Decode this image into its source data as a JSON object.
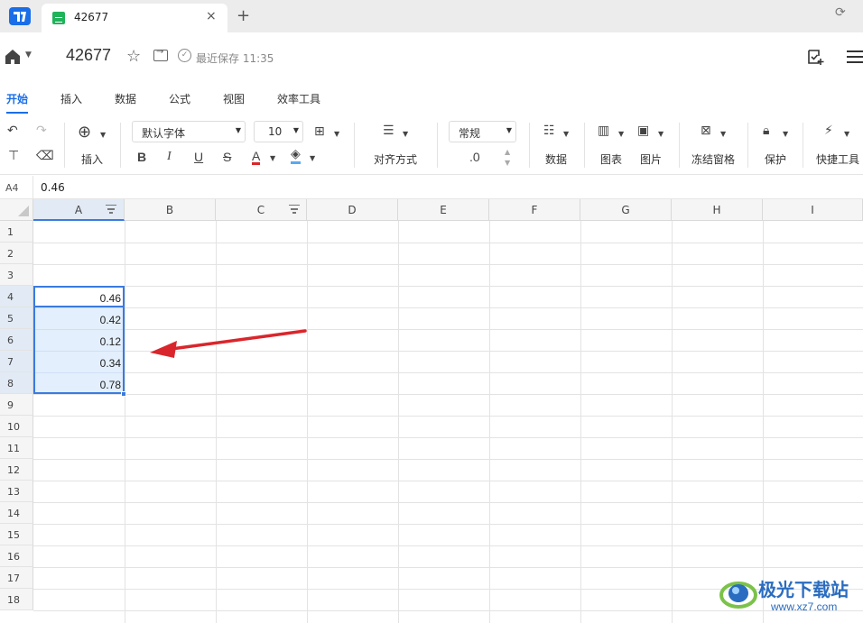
{
  "tab": {
    "title": "42677",
    "close": "×",
    "new": "+"
  },
  "header": {
    "title": "42677",
    "saved": "最近保存 11:35"
  },
  "ribbon_tabs": [
    "开始",
    "插入",
    "数据",
    "公式",
    "视图",
    "效率工具"
  ],
  "toolbar": {
    "insert_label": "插入",
    "font_name": "默认字体",
    "font_size": "10",
    "align_label": "对齐方式",
    "number_format": "常规",
    "decimal": ".0",
    "data_label": "数据",
    "chart_label": "图表",
    "image_label": "图片",
    "freeze_label": "冻结窗格",
    "protect_label": "保护",
    "quick_tools_label": "快捷工具",
    "bold": "B",
    "italic": "I",
    "underline": "U",
    "strike": "S",
    "font_color": "A"
  },
  "formula_bar": {
    "cell_ref": "A4",
    "value": "0.46"
  },
  "columns": [
    "A",
    "B",
    "C",
    "D",
    "E",
    "F",
    "G",
    "H",
    "I"
  ],
  "rows": [
    "1",
    "2",
    "3",
    "4",
    "5",
    "6",
    "7",
    "8",
    "9",
    "10",
    "11",
    "12",
    "13",
    "14",
    "15",
    "16",
    "17",
    "18"
  ],
  "cells": {
    "A4": "0.46",
    "A5": "0.42",
    "A6": "0.12",
    "A7": "0.34",
    "A8": "0.78"
  },
  "watermark": {
    "name": "极光下载站",
    "url": "www.xz7.com"
  },
  "colors": {
    "accent": "#1a6ee8",
    "selection": "#3a7be0",
    "annotation": "#d9262c"
  }
}
